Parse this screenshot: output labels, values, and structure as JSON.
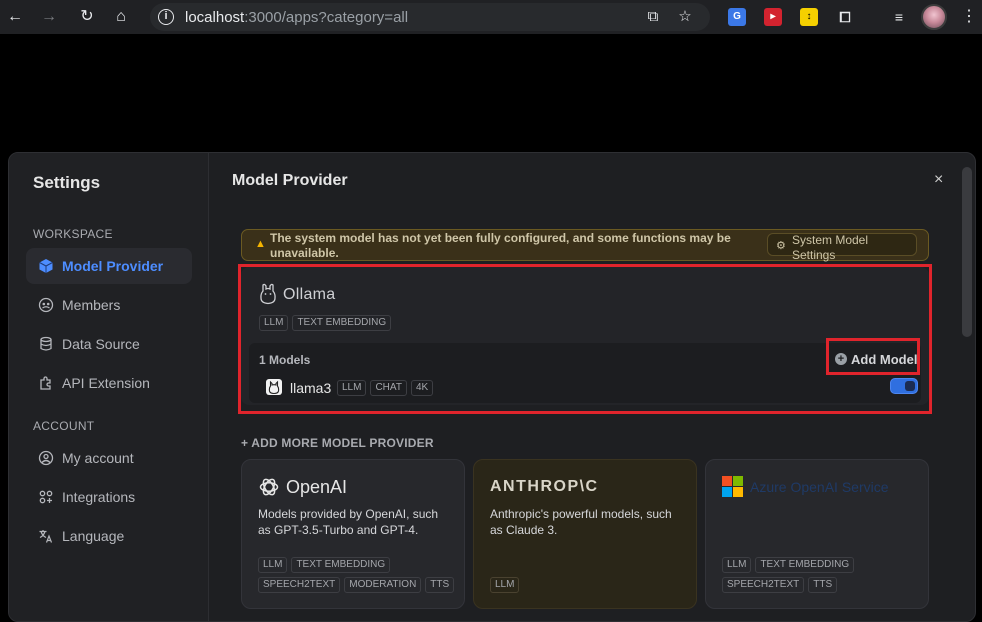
{
  "browser": {
    "url_host": "localhost",
    "url_path": ":3000/apps?category=all"
  },
  "settings": {
    "title": "Settings",
    "sections": [
      {
        "label": "WORKSPACE",
        "items": [
          {
            "label": "Model Provider",
            "icon": "cube-icon",
            "active": true
          },
          {
            "label": "Members",
            "icon": "members-icon"
          },
          {
            "label": "Data Source",
            "icon": "database-icon"
          },
          {
            "label": "API Extension",
            "icon": "puzzle-icon"
          }
        ]
      },
      {
        "label": "ACCOUNT",
        "items": [
          {
            "label": "My account",
            "icon": "user-icon"
          },
          {
            "label": "Integrations",
            "icon": "integrations-icon"
          },
          {
            "label": "Language",
            "icon": "language-icon"
          }
        ]
      }
    ]
  },
  "main": {
    "title": "Model Provider",
    "close": "×",
    "warning": {
      "text": "The system model has not yet been fully configured, and some functions may be unavailable.",
      "button": "System Model Settings"
    },
    "ollama": {
      "name": "Ollama",
      "tags": [
        "LLM",
        "TEXT EMBEDDING"
      ],
      "count": "1 Models",
      "add_model": "Add Model",
      "model": {
        "name": "llama3",
        "tags": [
          "LLM",
          "CHAT",
          "4K"
        ],
        "enabled": true
      }
    },
    "add_more": "+ ADD MORE MODEL PROVIDER",
    "providers": [
      {
        "name": "OpenAI",
        "description": "Models provided by OpenAI, such as GPT-3.5-Turbo and GPT-4.",
        "tags_row1": [
          "LLM",
          "TEXT EMBEDDING"
        ],
        "tags_row2": [
          "SPEECH2TEXT",
          "MODERATION",
          "TTS"
        ]
      },
      {
        "name": "ANTHROP\\C",
        "description": "Anthropic's powerful models, such as Claude 3.",
        "tags_row1": [],
        "tags_row2": [
          "LLM"
        ]
      },
      {
        "name": "Azure OpenAI Service",
        "description": "",
        "tags_row1": [
          "LLM",
          "TEXT EMBEDDING"
        ],
        "tags_row2": [
          "SPEECH2TEXT",
          "TTS"
        ]
      }
    ]
  },
  "colors": {
    "accent": "#4d8dff",
    "highlight": "#e0242c",
    "warning": "#f5b400"
  }
}
